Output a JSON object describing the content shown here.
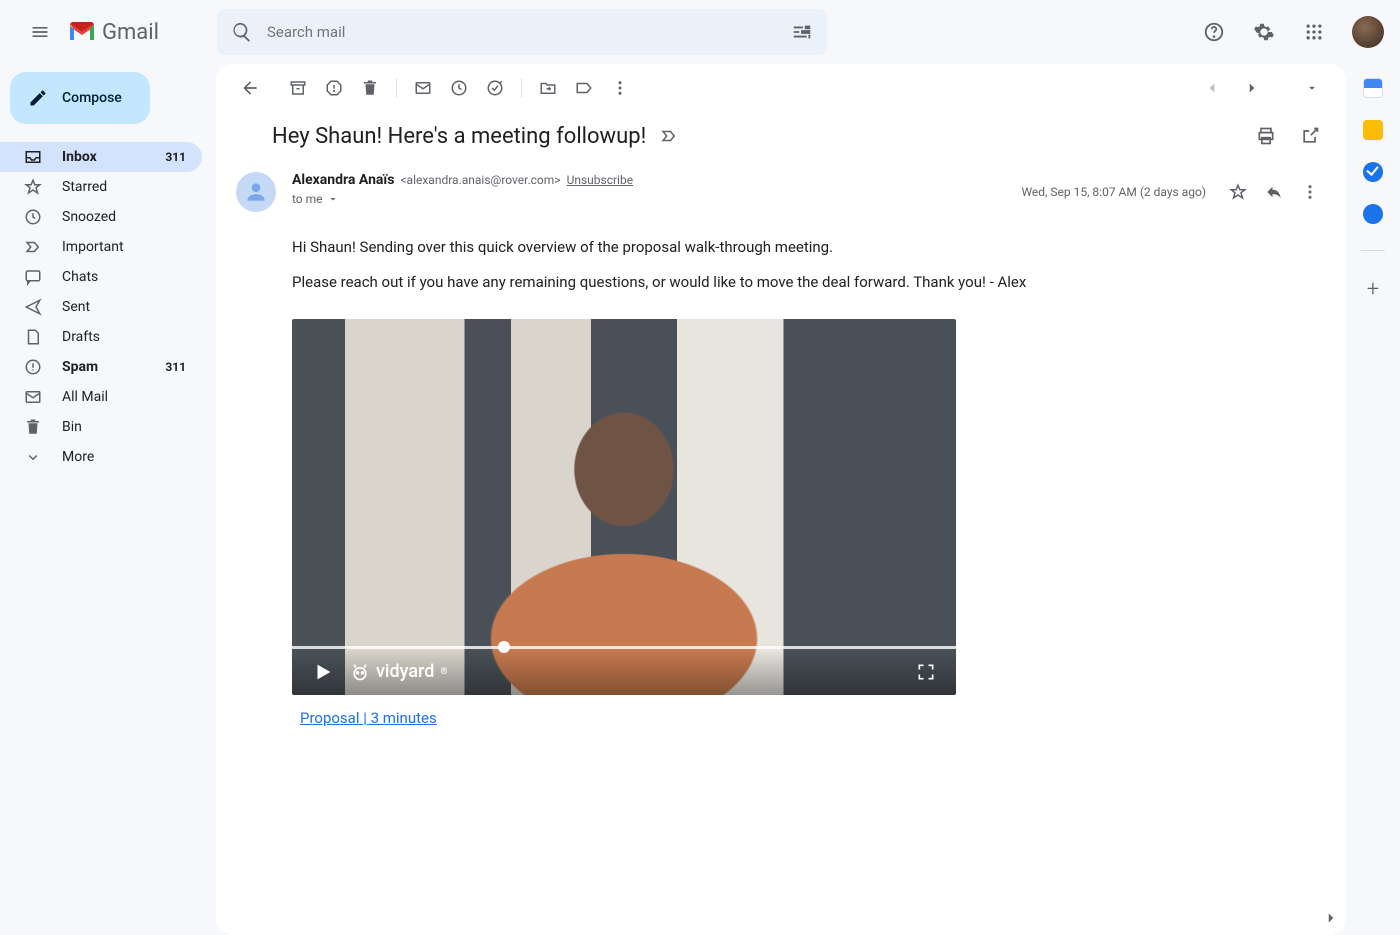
{
  "header": {
    "app_name": "Gmail",
    "search_placeholder": "Search mail"
  },
  "compose_label": "Compose",
  "nav": [
    {
      "icon": "inbox",
      "label": "Inbox",
      "count": "311",
      "active": true,
      "bold": true
    },
    {
      "icon": "star",
      "label": "Starred"
    },
    {
      "icon": "clock",
      "label": "Snoozed"
    },
    {
      "icon": "important",
      "label": "Important"
    },
    {
      "icon": "chat",
      "label": "Chats"
    },
    {
      "icon": "send",
      "label": "Sent"
    },
    {
      "icon": "draft",
      "label": "Drafts"
    },
    {
      "icon": "spam",
      "label": "Spam",
      "count": "311",
      "bold": true
    },
    {
      "icon": "allmail",
      "label": "All Mail"
    },
    {
      "icon": "bin",
      "label": "Bin"
    },
    {
      "icon": "more",
      "label": "More"
    }
  ],
  "email": {
    "subject": "Hey Shaun! Here's a meeting followup!",
    "sender_name": "Alexandra Anaïs",
    "sender_email": "<alexandra.anais@rover.com>",
    "unsubscribe": "Unsubscribe",
    "to_line": "to me",
    "date": "Wed, Sep 15, 8:07 AM (2 days ago)",
    "body_p1": "Hi Shaun! Sending over this quick overview of the proposal walk-through meeting.",
    "body_p2": "Please reach out if you have any remaining questions, or would like to move the deal forward. Thank you! - Alex",
    "video_brand": "vidyard",
    "video_link": "Proposal | 3 minutes"
  }
}
